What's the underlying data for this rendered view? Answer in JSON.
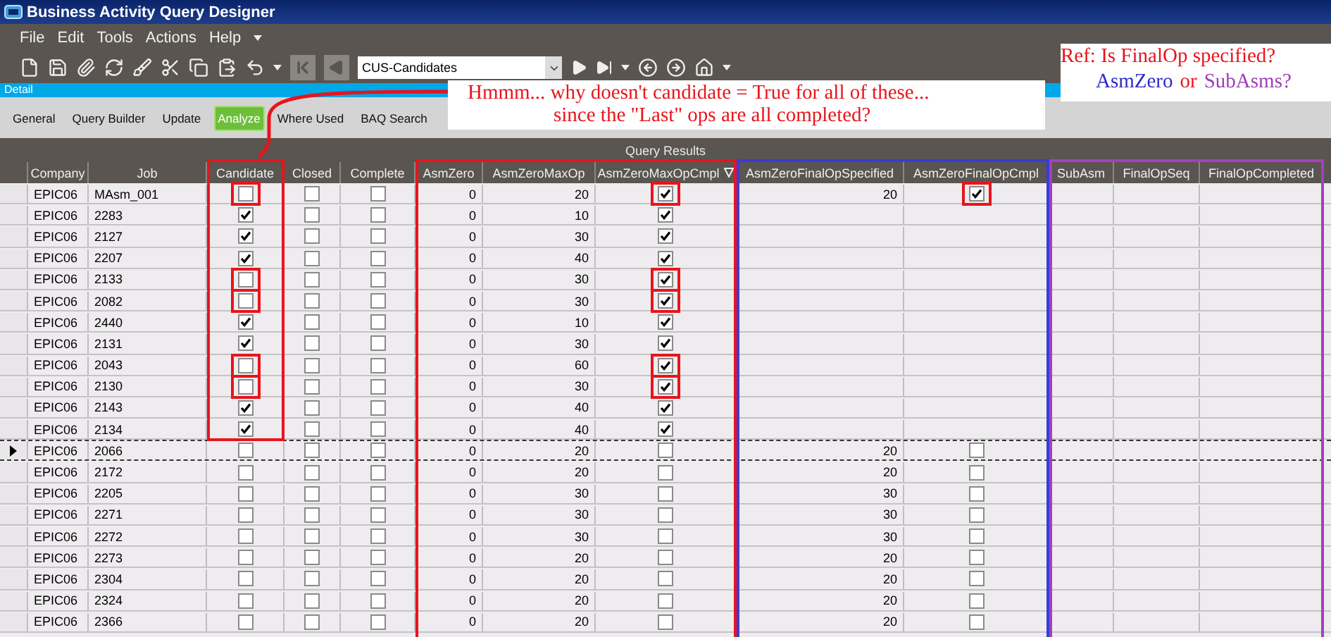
{
  "window": {
    "title": "Business Activity Query Designer"
  },
  "menu": [
    "File",
    "Edit",
    "Tools",
    "Actions",
    "Help"
  ],
  "toolbar": {
    "query_combo": "CUS-Candidates"
  },
  "panel": {
    "title": "Detail"
  },
  "tabs": [
    {
      "label": "General",
      "selected": false
    },
    {
      "label": "Query Builder",
      "selected": false
    },
    {
      "label": "Update",
      "selected": false
    },
    {
      "label": "Analyze",
      "selected": true
    },
    {
      "label": "Where Used",
      "selected": false
    },
    {
      "label": "BAQ Search",
      "selected": false
    }
  ],
  "results": {
    "title": "Query Results",
    "columns": [
      {
        "label": "Company",
        "sorted": false
      },
      {
        "label": "Job",
        "sorted": false
      },
      {
        "label": "Candidate",
        "sorted": false,
        "color": "#e8141c",
        "frame_short": true
      },
      {
        "label": "Closed",
        "sorted": false
      },
      {
        "label": "Complete",
        "sorted": false
      },
      {
        "label": "AsmZero",
        "sorted": false,
        "color": "#e8141c"
      },
      {
        "label": "AsmZeroMaxOp",
        "sorted": false,
        "color": "#e8141c"
      },
      {
        "label": "AsmZeroMaxOpCmpl",
        "sorted": true,
        "color": "#e8141c"
      },
      {
        "label": "AsmZeroFinalOpSpecified",
        "sorted": false,
        "color": "#3b3bd6"
      },
      {
        "label": "AsmZeroFinalOpCmpl",
        "sorted": false,
        "color": "#3b3bd6"
      },
      {
        "label": "SubAsm",
        "sorted": false,
        "color": "#a43fc0"
      },
      {
        "label": "FinalOpSeq",
        "sorted": false,
        "color": "#a43fc0"
      },
      {
        "label": "FinalOpCompleted",
        "sorted": false,
        "color": "#a43fc0"
      }
    ],
    "rows": [
      {
        "current": false,
        "flagged": true,
        "company": "EPIC06",
        "job": "MAsm_001",
        "candidate": false,
        "closed": false,
        "complete": false,
        "asm_zero": "0",
        "max_op": "20",
        "max_op_cmpl": true,
        "final_op_specified": "20",
        "final_op_cmpl": true
      },
      {
        "current": false,
        "flagged": false,
        "company": "EPIC06",
        "job": "2283",
        "candidate": true,
        "closed": false,
        "complete": false,
        "asm_zero": "0",
        "max_op": "10",
        "max_op_cmpl": true
      },
      {
        "current": false,
        "flagged": false,
        "company": "EPIC06",
        "job": "2127",
        "candidate": true,
        "closed": false,
        "complete": false,
        "asm_zero": "0",
        "max_op": "30",
        "max_op_cmpl": true
      },
      {
        "current": false,
        "flagged": false,
        "company": "EPIC06",
        "job": "2207",
        "candidate": true,
        "closed": false,
        "complete": false,
        "asm_zero": "0",
        "max_op": "40",
        "max_op_cmpl": true
      },
      {
        "current": false,
        "flagged": true,
        "company": "EPIC06",
        "job": "2133",
        "candidate": false,
        "closed": false,
        "complete": false,
        "asm_zero": "0",
        "max_op": "30",
        "max_op_cmpl": true
      },
      {
        "current": false,
        "flagged": true,
        "company": "EPIC06",
        "job": "2082",
        "candidate": false,
        "closed": false,
        "complete": false,
        "asm_zero": "0",
        "max_op": "30",
        "max_op_cmpl": true
      },
      {
        "current": false,
        "flagged": false,
        "company": "EPIC06",
        "job": "2440",
        "candidate": true,
        "closed": false,
        "complete": false,
        "asm_zero": "0",
        "max_op": "10",
        "max_op_cmpl": true
      },
      {
        "current": false,
        "flagged": false,
        "company": "EPIC06",
        "job": "2131",
        "candidate": true,
        "closed": false,
        "complete": false,
        "asm_zero": "0",
        "max_op": "30",
        "max_op_cmpl": true
      },
      {
        "current": false,
        "flagged": true,
        "company": "EPIC06",
        "job": "2043",
        "candidate": false,
        "closed": false,
        "complete": false,
        "asm_zero": "0",
        "max_op": "60",
        "max_op_cmpl": true
      },
      {
        "current": false,
        "flagged": true,
        "company": "EPIC06",
        "job": "2130",
        "candidate": false,
        "closed": false,
        "complete": false,
        "asm_zero": "0",
        "max_op": "30",
        "max_op_cmpl": true
      },
      {
        "current": false,
        "flagged": false,
        "company": "EPIC06",
        "job": "2143",
        "candidate": true,
        "closed": false,
        "complete": false,
        "asm_zero": "0",
        "max_op": "40",
        "max_op_cmpl": true
      },
      {
        "current": false,
        "flagged": false,
        "company": "EPIC06",
        "job": "2134",
        "candidate": true,
        "closed": false,
        "complete": false,
        "asm_zero": "0",
        "max_op": "40",
        "max_op_cmpl": true
      },
      {
        "current": true,
        "flagged": false,
        "company": "EPIC06",
        "job": "2066",
        "candidate": false,
        "closed": false,
        "complete": false,
        "asm_zero": "0",
        "max_op": "20",
        "max_op_cmpl": false,
        "final_op_specified": "20",
        "final_op_cmpl": false
      },
      {
        "current": false,
        "flagged": false,
        "company": "EPIC06",
        "job": "2172",
        "candidate": false,
        "closed": false,
        "complete": false,
        "asm_zero": "0",
        "max_op": "20",
        "max_op_cmpl": false,
        "final_op_specified": "20",
        "final_op_cmpl": false
      },
      {
        "current": false,
        "flagged": false,
        "company": "EPIC06",
        "job": "2205",
        "candidate": false,
        "closed": false,
        "complete": false,
        "asm_zero": "0",
        "max_op": "30",
        "max_op_cmpl": false,
        "final_op_specified": "30",
        "final_op_cmpl": false
      },
      {
        "current": false,
        "flagged": false,
        "company": "EPIC06",
        "job": "2271",
        "candidate": false,
        "closed": false,
        "complete": false,
        "asm_zero": "0",
        "max_op": "30",
        "max_op_cmpl": false,
        "final_op_specified": "30",
        "final_op_cmpl": false
      },
      {
        "current": false,
        "flagged": false,
        "company": "EPIC06",
        "job": "2272",
        "candidate": false,
        "closed": false,
        "complete": false,
        "asm_zero": "0",
        "max_op": "30",
        "max_op_cmpl": false,
        "final_op_specified": "30",
        "final_op_cmpl": false
      },
      {
        "current": false,
        "flagged": false,
        "company": "EPIC06",
        "job": "2273",
        "candidate": false,
        "closed": false,
        "complete": false,
        "asm_zero": "0",
        "max_op": "20",
        "max_op_cmpl": false,
        "final_op_specified": "20",
        "final_op_cmpl": false
      },
      {
        "current": false,
        "flagged": false,
        "company": "EPIC06",
        "job": "2304",
        "candidate": false,
        "closed": false,
        "complete": false,
        "asm_zero": "0",
        "max_op": "20",
        "max_op_cmpl": false,
        "final_op_specified": "20",
        "final_op_cmpl": false
      },
      {
        "current": false,
        "flagged": false,
        "company": "EPIC06",
        "job": "2324",
        "candidate": false,
        "closed": false,
        "complete": false,
        "asm_zero": "0",
        "max_op": "20",
        "max_op_cmpl": false,
        "final_op_specified": "20",
        "final_op_cmpl": false
      },
      {
        "current": false,
        "flagged": false,
        "company": "EPIC06",
        "job": "2366",
        "candidate": false,
        "closed": false,
        "complete": false,
        "asm_zero": "0",
        "max_op": "20",
        "max_op_cmpl": false,
        "final_op_specified": "20",
        "final_op_cmpl": false
      }
    ]
  },
  "annotations": {
    "callout": [
      "Hmmm... why doesn't candidate = True for all of these...",
      "since the \"Last\" ops are all completed?"
    ],
    "ref": {
      "question": "Ref: Is FinalOp specified?",
      "options": [
        {
          "text": "AsmZero",
          "color": "#2b2bc8"
        },
        {
          "text": "or",
          "color": "#e8141c"
        },
        {
          "text": "SubAsms?",
          "color": "#9b3fb8"
        }
      ]
    }
  }
}
